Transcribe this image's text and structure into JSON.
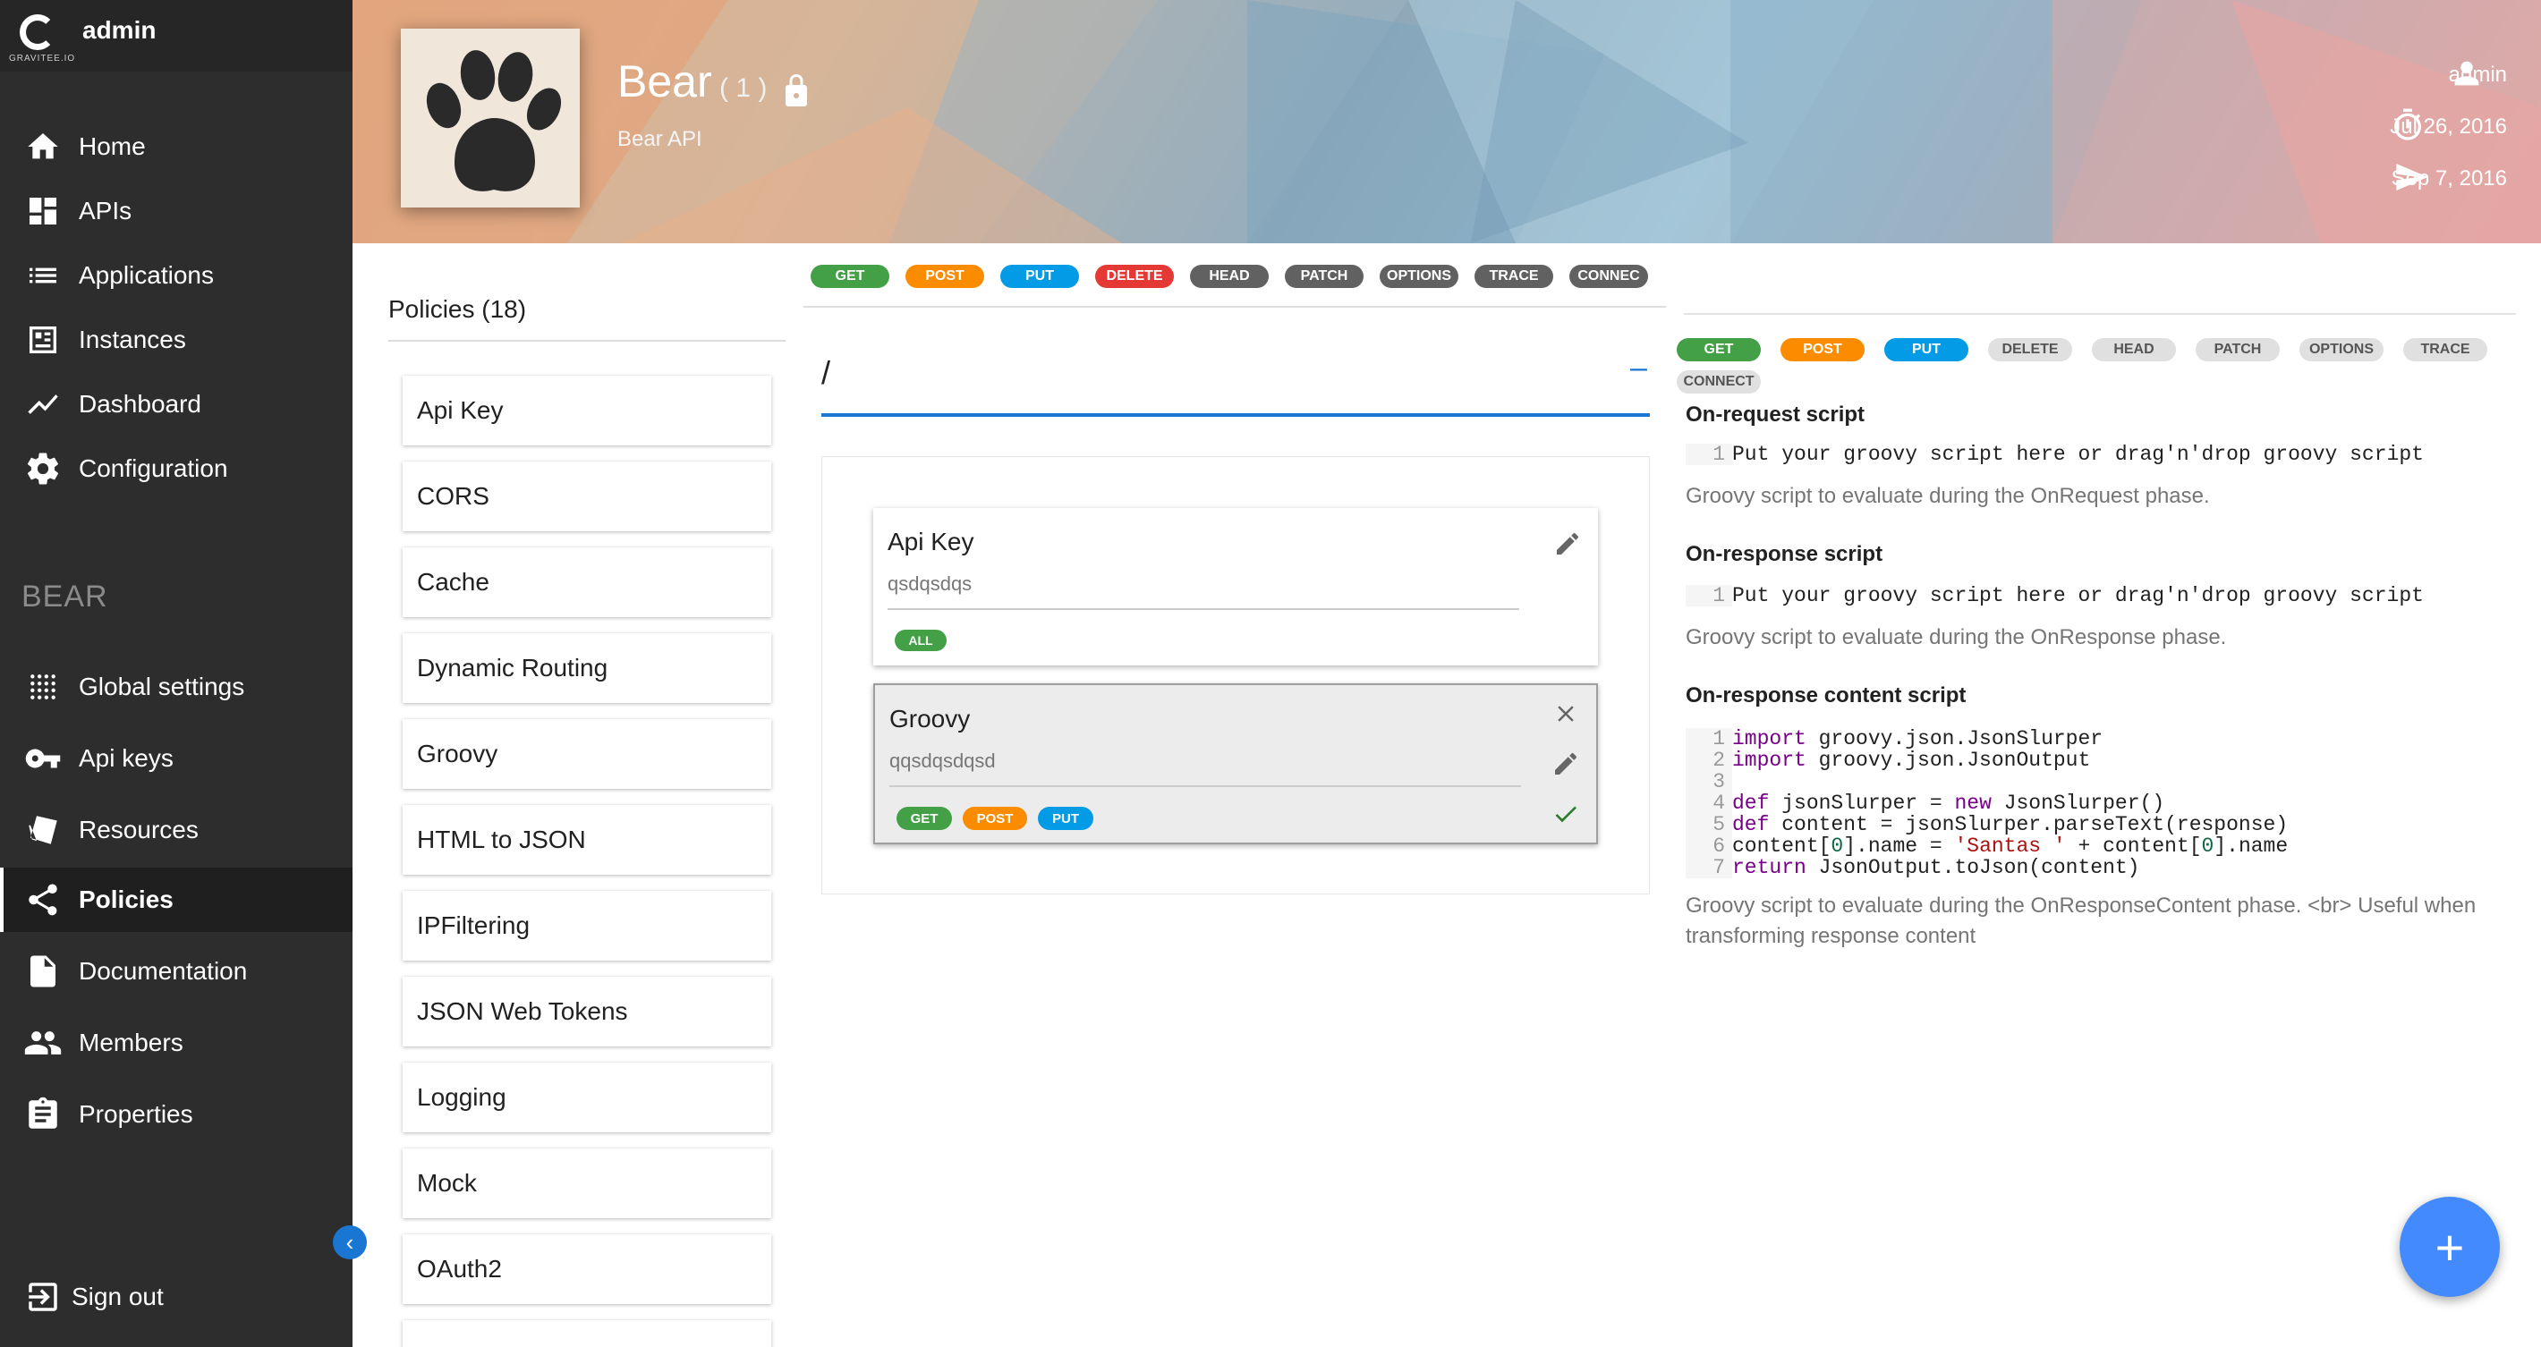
{
  "brand": {
    "user": "admin",
    "logo_text": "GRAVITEE.IO"
  },
  "nav": {
    "main": [
      {
        "label": "Home",
        "icon": "home-icon"
      },
      {
        "label": "APIs",
        "icon": "dashboard-grid-icon"
      },
      {
        "label": "Applications",
        "icon": "list-icon"
      },
      {
        "label": "Instances",
        "icon": "instances-icon"
      },
      {
        "label": "Dashboard",
        "icon": "trending-up-icon"
      },
      {
        "label": "Configuration",
        "icon": "gear-icon"
      }
    ],
    "section_title": "BEAR",
    "api": [
      {
        "label": "Global settings",
        "icon": "dots-grid-icon"
      },
      {
        "label": "Api keys",
        "icon": "key-icon"
      },
      {
        "label": "Resources",
        "icon": "resources-icon"
      },
      {
        "label": "Policies",
        "icon": "share-icon",
        "active": true
      },
      {
        "label": "Documentation",
        "icon": "document-icon"
      },
      {
        "label": "Members",
        "icon": "people-icon"
      },
      {
        "label": "Properties",
        "icon": "clipboard-icon"
      }
    ],
    "sign_out": "Sign out"
  },
  "header": {
    "api_name": "Bear",
    "api_version": "( 1 )",
    "api_description": "Bear API",
    "owner": "admin",
    "created": "Jul 26, 2016",
    "deployed": "Sep 7, 2016"
  },
  "policies": {
    "title": "Policies (18)",
    "items": [
      "Api Key",
      "CORS",
      "Cache",
      "Dynamic Routing",
      "Groovy",
      "HTML to JSON",
      "IPFiltering",
      "JSON Web Tokens",
      "Logging",
      "Mock",
      "OAuth2"
    ]
  },
  "methods": [
    "GET",
    "POST",
    "PUT",
    "DELETE",
    "HEAD",
    "PATCH",
    "OPTIONS",
    "TRACE",
    "CONNECT"
  ],
  "methods_truncated_top": [
    "GET",
    "POST",
    "PUT",
    "DELETE",
    "HEAD",
    "PATCH",
    "OPTIONS",
    "TRACE",
    "CONNEC"
  ],
  "path": {
    "value": "/",
    "collapse": "–"
  },
  "flow": [
    {
      "name": "Api Key",
      "description": "qsdqsdqs",
      "methods": [
        "ALL"
      ]
    },
    {
      "name": "Groovy",
      "description": "qqsdqsdqsd",
      "methods": [
        "GET",
        "POST",
        "PUT"
      ],
      "selected": true
    }
  ],
  "groovy": {
    "on_request": {
      "title": "On-request script",
      "code": "Put your groovy script here or drag'n'drop groovy script",
      "hint": "Groovy script to evaluate during the OnRequest phase."
    },
    "on_response": {
      "title": "On-response script",
      "code": "Put your groovy script here or drag'n'drop groovy script",
      "hint": "Groovy script to evaluate during the OnResponse phase."
    },
    "on_response_content": {
      "title": "On-response content script",
      "hint": "Groovy script to evaluate during the OnResponseContent phase. <br> Useful when transforming response content"
    }
  },
  "fab": "+"
}
